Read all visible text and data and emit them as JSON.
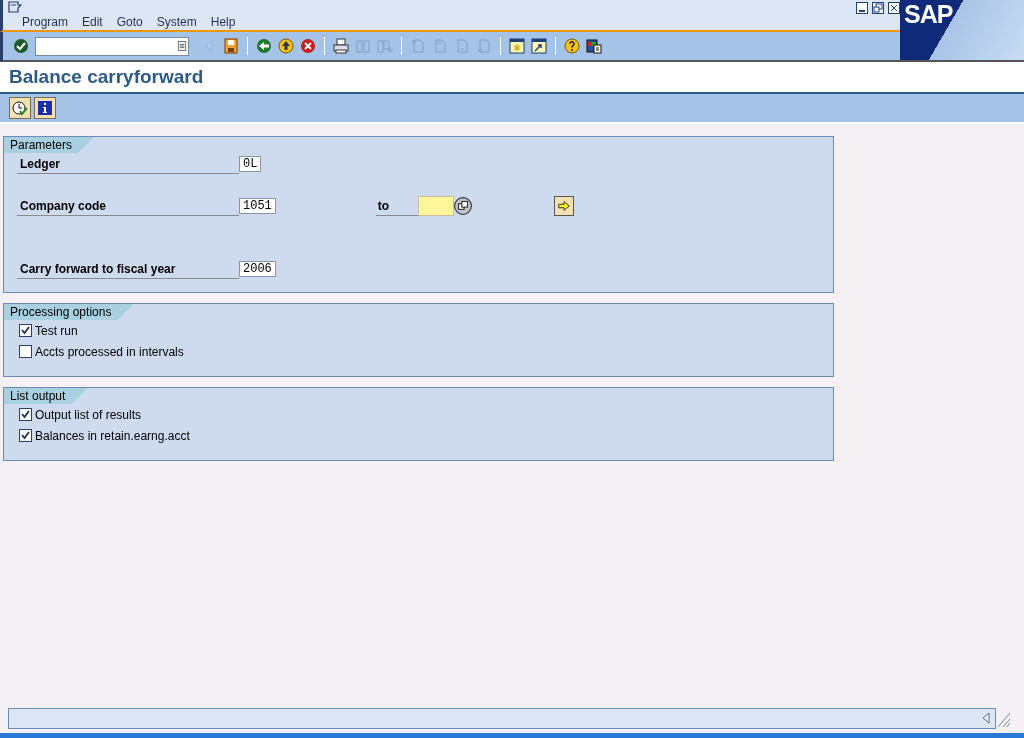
{
  "menu": [
    {
      "label": "Program"
    },
    {
      "label": "Edit"
    },
    {
      "label": "Goto"
    },
    {
      "label": "System"
    },
    {
      "label": "Help"
    }
  ],
  "logo": "SAP",
  "toolbar": [
    {
      "kind": "enter",
      "disabled": false
    },
    {
      "kind": "command-field"
    },
    {
      "kind": "expand",
      "disabled": true
    },
    {
      "kind": "save",
      "disabled": false
    },
    {
      "kind": "sep"
    },
    {
      "kind": "back",
      "disabled": false
    },
    {
      "kind": "exit",
      "disabled": false
    },
    {
      "kind": "cancel",
      "disabled": false
    },
    {
      "kind": "sep"
    },
    {
      "kind": "print",
      "disabled": false
    },
    {
      "kind": "find",
      "disabled": true
    },
    {
      "kind": "find-next",
      "disabled": true
    },
    {
      "kind": "sep"
    },
    {
      "kind": "first",
      "disabled": true
    },
    {
      "kind": "prev",
      "disabled": true
    },
    {
      "kind": "next",
      "disabled": true
    },
    {
      "kind": "last",
      "disabled": true
    },
    {
      "kind": "sep"
    },
    {
      "kind": "session",
      "disabled": false
    },
    {
      "kind": "shortcut",
      "disabled": false
    },
    {
      "kind": "sep"
    },
    {
      "kind": "help",
      "disabled": false
    },
    {
      "kind": "layout",
      "disabled": false
    }
  ],
  "title": "Balance carryforward",
  "app_toolbar": [
    {
      "kind": "execute"
    },
    {
      "kind": "info"
    }
  ],
  "groups": [
    {
      "title": "Parameters",
      "rows": [
        {
          "kind": "field",
          "label": "Ledger",
          "value": "0L"
        },
        {
          "kind": "field",
          "label": "Company code",
          "value": "1051",
          "range": {
            "label": "to"
          }
        },
        {
          "kind": "gap"
        },
        {
          "kind": "field",
          "label": "Carry forward to fiscal year",
          "value": "2006"
        }
      ]
    },
    {
      "title": "Processing options",
      "rows": [
        {
          "kind": "checkbox",
          "label": "Test run",
          "checked": true
        },
        {
          "kind": "checkbox",
          "label": "Accts processed in intervals",
          "checked": false
        }
      ]
    },
    {
      "title": "List output",
      "rows": [
        {
          "kind": "checkbox",
          "label": "Output list of results",
          "checked": true
        },
        {
          "kind": "checkbox",
          "label": "Balances in retain.earng.acct",
          "checked": true
        }
      ]
    }
  ]
}
